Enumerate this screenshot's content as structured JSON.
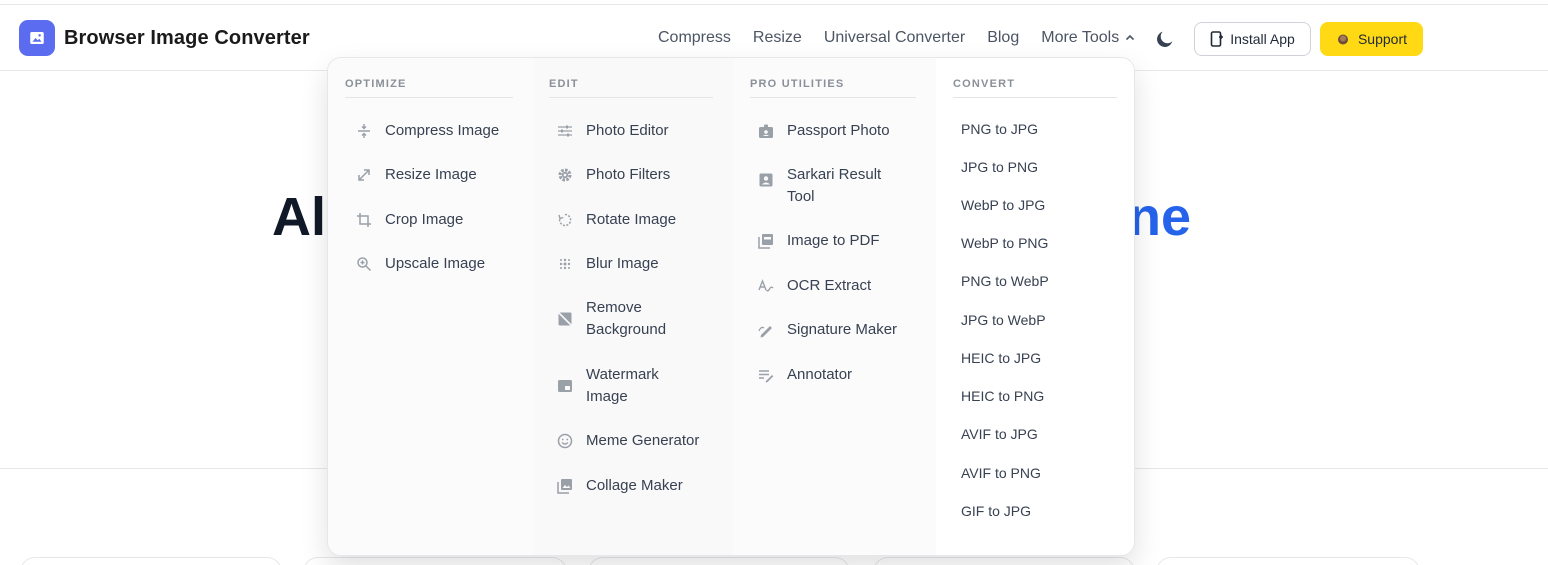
{
  "brand": {
    "name": "Browser Image Converter"
  },
  "nav": {
    "items": [
      "Compress",
      "Resize",
      "Universal Converter",
      "Blog"
    ],
    "more_tools": "More Tools"
  },
  "actions": {
    "install": "Install App",
    "support": "Support"
  },
  "hero": {
    "left_fragment": "Al",
    "right_fragment": "ne"
  },
  "menu": {
    "optimize": {
      "heading": "OPTIMIZE",
      "items": [
        {
          "label": "Compress Image",
          "icon": "compress-icon"
        },
        {
          "label": "Resize Image",
          "icon": "resize-arrow-icon"
        },
        {
          "label": "Crop Image",
          "icon": "crop-icon"
        },
        {
          "label": "Upscale Image",
          "icon": "zoom-in-icon"
        }
      ]
    },
    "edit": {
      "heading": "EDIT",
      "items": [
        {
          "label": "Photo Editor",
          "icon": "sliders-icon"
        },
        {
          "label": "Photo Filters",
          "icon": "gear-icon"
        },
        {
          "label": "Rotate Image",
          "icon": "rotate-icon"
        },
        {
          "label": "Blur Image",
          "icon": "blur-icon"
        },
        {
          "label": "Remove\nBackground",
          "icon": "hide-image-icon"
        },
        {
          "label": "Watermark\nImage",
          "icon": "watermark-icon"
        },
        {
          "label": "Meme Generator",
          "icon": "smiley-icon"
        },
        {
          "label": "Collage Maker",
          "icon": "collage-icon"
        }
      ]
    },
    "pro": {
      "heading": "PRO UTILITIES",
      "items": [
        {
          "label": "Passport Photo",
          "icon": "id-badge-icon"
        },
        {
          "label": "Sarkari Result\nTool",
          "icon": "portrait-icon"
        },
        {
          "label": "Image to PDF",
          "icon": "pdf-icon"
        },
        {
          "label": "OCR Extract",
          "icon": "ocr-icon"
        },
        {
          "label": "Signature Maker",
          "icon": "signature-icon"
        },
        {
          "label": "Annotator",
          "icon": "annotate-icon"
        }
      ]
    },
    "convert": {
      "heading": "CONVERT",
      "items": [
        "PNG to JPG",
        "JPG to PNG",
        "WebP to JPG",
        "WebP to PNG",
        "PNG to WebP",
        "JPG to WebP",
        "HEIC to JPG",
        "HEIC to PNG",
        "AVIF to JPG",
        "AVIF to PNG",
        "GIF to JPG"
      ]
    }
  },
  "colors": {
    "logo_bg": "#5b6cf0",
    "support_bg": "#ffd914",
    "accent_blue": "#2563eb",
    "icon_gray": "#9aa0a8"
  }
}
